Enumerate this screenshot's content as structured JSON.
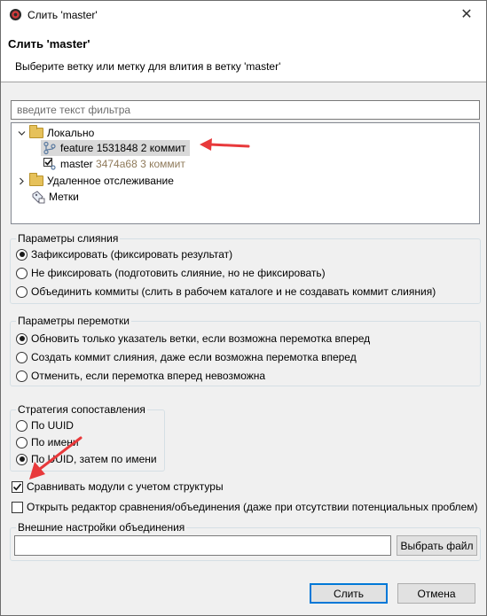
{
  "window": {
    "title": "Слить 'master'",
    "close_glyph": "✕"
  },
  "header": {
    "title": "Слить 'master'",
    "description": "Выберите ветку или метку для влития в ветку 'master'"
  },
  "filter": {
    "placeholder": "введите текст фильтра",
    "value": ""
  },
  "tree": {
    "local": {
      "label": "Локально",
      "items": [
        {
          "name": "feature",
          "hash": "1531848",
          "info": "2 коммит",
          "selected": true
        },
        {
          "name": "master",
          "hash": "3474a68",
          "info": "3 коммит",
          "selected": false
        }
      ]
    },
    "remote": {
      "label": "Удаленное отслеживание"
    },
    "tags": {
      "label": "Метки"
    }
  },
  "merge_options": {
    "title": "Параметры слияния",
    "options": [
      {
        "label": "Зафиксировать (фиксировать результат)",
        "checked": true
      },
      {
        "label": "Не фиксировать (подготовить слияние, но не фиксировать)",
        "checked": false
      },
      {
        "label": "Объединить коммиты (слить в рабочем каталоге и не создавать коммит слияния)",
        "checked": false
      }
    ]
  },
  "ff_options": {
    "title": "Параметры перемотки",
    "options": [
      {
        "label": "Обновить только указатель ветки, если возможна перемотка вперед",
        "checked": true
      },
      {
        "label": "Создать коммит слияния, даже если возможна перемотка вперед",
        "checked": false
      },
      {
        "label": "Отменить, если перемотка вперед невозможна",
        "checked": false
      }
    ]
  },
  "match_strategy": {
    "title": "Стратегия сопоставления",
    "options": [
      {
        "label": "По UUID",
        "checked": false
      },
      {
        "label": "По имени",
        "checked": false
      },
      {
        "label": "По UUID, затем по имени",
        "checked": true
      }
    ]
  },
  "compare_structure": {
    "label": "Сравнивать модули с учетом структуры",
    "checked": true
  },
  "open_editor": {
    "label": "Открыть редактор сравнения/объединения (даже при отсутствии потенциальных проблем)",
    "checked": false
  },
  "external": {
    "title": "Внешние настройки объединения",
    "value": "",
    "choose_label": "Выбрать файл"
  },
  "buttons": {
    "merge": "Слить",
    "cancel": "Отмена"
  },
  "colors": {
    "arrow": "#e8393b",
    "muted_text": "#8f7a5a",
    "selection": "#d9d9d9"
  }
}
